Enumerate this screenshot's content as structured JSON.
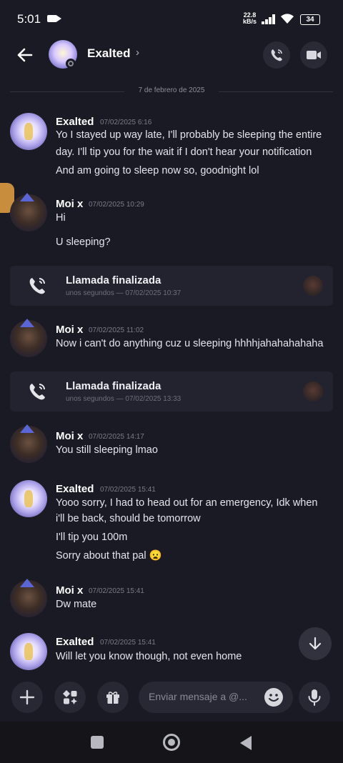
{
  "status_bar": {
    "time": "5:01",
    "speed_value": "22.8",
    "speed_unit": "kB/s",
    "battery": "34"
  },
  "header": {
    "name": "Exalted",
    "chevron": "›"
  },
  "date_divider": "7 de febrero de 2025",
  "messages": [
    {
      "author": "Exalted",
      "timestamp": "07/02/2025 6:16",
      "lines": [
        "Yo I stayed up way late, I'll probably be sleeping the entire",
        "day. I'll tip you for the wait if I don't hear your notification",
        "And am going to sleep now so, goodnight lol"
      ]
    },
    {
      "author": "Moi x",
      "timestamp": "07/02/2025 10:29",
      "lines": [
        "Hi",
        "U sleeping?"
      ]
    },
    {
      "author": "Moi x",
      "timestamp": "07/02/2025 11:02",
      "lines": [
        "Now i can't do anything cuz u sleeping hhhhjahahahahaha"
      ]
    },
    {
      "author": "Moi x",
      "timestamp": "07/02/2025 14:17",
      "lines": [
        "You still sleeping lmao"
      ]
    },
    {
      "author": "Exalted",
      "timestamp": "07/02/2025 15:41",
      "lines": [
        "Yooo sorry, I had to head out for an emergency, Idk when",
        "i'll be back, should be tomorrow",
        "I'll tip you 100m",
        "Sorry about that pal 😦"
      ]
    },
    {
      "author": "Moi x",
      "timestamp": "07/02/2025 15:41",
      "lines": [
        "Dw mate"
      ]
    },
    {
      "author": "Exalted",
      "timestamp": "07/02/2025 15:41",
      "lines": [
        "Will let you know though, not even home"
      ]
    }
  ],
  "calls": [
    {
      "title": "Llamada finalizada",
      "subtitle": "unos segundos — 07/02/2025 10:37"
    },
    {
      "title": "Llamada finalizada",
      "subtitle": "unos segundos — 07/02/2025 13:33"
    }
  ],
  "composer": {
    "placeholder": "Enviar mensaje a @..."
  },
  "icons": {
    "back": "arrow-left-icon",
    "call": "phone-call-icon",
    "video": "video-camera-icon",
    "add": "plus-icon",
    "apps": "apps-icon",
    "gift": "gift-icon",
    "emoji": "emoji-icon",
    "mic": "microphone-icon",
    "scroll": "arrow-down-icon"
  },
  "colors": {
    "background": "#1a1a24",
    "card": "#23232f",
    "text": "#e4e4ea",
    "muted": "#7c7c88"
  }
}
